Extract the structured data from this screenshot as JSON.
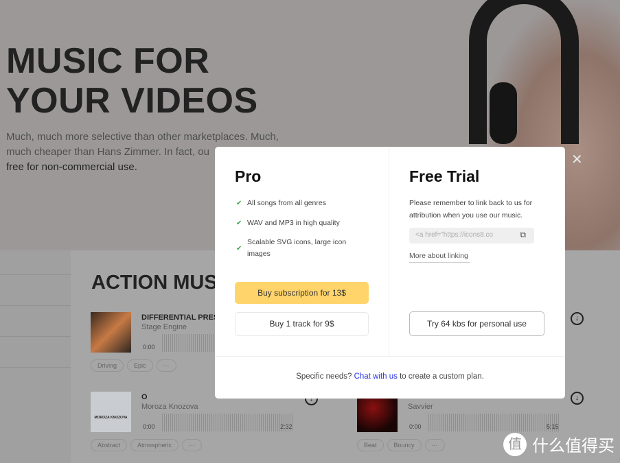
{
  "hero": {
    "title_line1": "MUSIC FOR",
    "title_line2": "YOUR VIDEOS",
    "subtitle": "Much, much more selective than other marketplaces. Much, much cheaper than Hans Zimmer. In fact, ou",
    "subtitle_end": "free for non-commercial use."
  },
  "section": {
    "title": "ACTION MUS"
  },
  "tracks": [
    {
      "title": "DIFFERENTIAL PRESS",
      "artist": "Stage Engine",
      "time_start": "0:00",
      "tags": [
        "Driving",
        "Epic"
      ]
    },
    {
      "title": "O",
      "artist": "Moroza Knozova",
      "time_start": "0:00",
      "time_end": "2:32",
      "tags": [
        "Abstract",
        "Atmospheric"
      ],
      "cover_text": "MOROZA KNOZOVA"
    },
    {
      "artist": "Savvier",
      "time_start": "0:00",
      "time_end": "5:15",
      "tags": [
        "Beat",
        "Bouncy"
      ]
    }
  ],
  "more_label": "···",
  "modal": {
    "pro": {
      "title": "Pro",
      "features": [
        "All songs from all genres",
        "WAV and MP3 in high quality",
        "Scalable SVG icons, large icon images"
      ],
      "buy_subscription": "Buy subscription for 13$",
      "buy_track": "Buy 1 track for 9$"
    },
    "free": {
      "title": "Free Trial",
      "note": "Please remember to link back to us for attribution when you use our music.",
      "code_value": "<a href=\"https://icons8.co",
      "more_link": "More about linking",
      "try_button": "Try 64 kbs for personal use"
    },
    "footer": {
      "before": "Specific needs?",
      "link": "Chat with us",
      "after": "to create a custom plan."
    },
    "accent_color": "#ffd46b",
    "link_color": "#2a35e6"
  },
  "watermark": {
    "text": "什么值得买",
    "glyph": "值"
  }
}
